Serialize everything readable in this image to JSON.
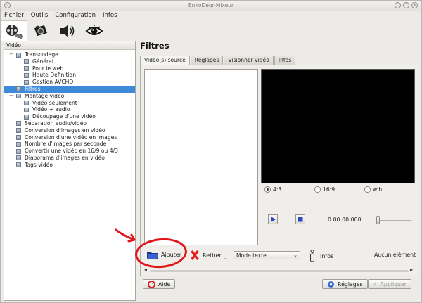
{
  "window": {
    "title": "EnKoDeur-Mixeur"
  },
  "menu": {
    "items": [
      {
        "label": "Fichier"
      },
      {
        "label": "Outils"
      },
      {
        "label": "Configuration"
      },
      {
        "label": "Infos"
      }
    ]
  },
  "toolbar": {
    "icons": [
      "film-reel-icon",
      "camera-icon",
      "speaker-icon",
      "eye-icon"
    ],
    "active_index": 0
  },
  "tree": {
    "header": "Vidéo",
    "items": [
      {
        "label": "Transcodage",
        "level": 0,
        "expanded": true
      },
      {
        "label": "Général",
        "level": 1
      },
      {
        "label": "Pour le web",
        "level": 1
      },
      {
        "label": "Haute Définition",
        "level": 1
      },
      {
        "label": "Gestion AVCHD",
        "level": 1
      },
      {
        "label": "Filtres",
        "level": 0,
        "selected": true
      },
      {
        "label": "Montage vidéo",
        "level": 0,
        "expanded": true
      },
      {
        "label": "Vidéo seulement",
        "level": 1
      },
      {
        "label": "Vidéo + audio",
        "level": 1
      },
      {
        "label": "Découpage d'une vidéo",
        "level": 1
      },
      {
        "label": "Séparation audio/vidéo",
        "level": 0
      },
      {
        "label": "Conversion d'images en vidéo",
        "level": 0
      },
      {
        "label": "Conversion d'une vidéo en images",
        "level": 0
      },
      {
        "label": "Nombre d'images par seconde",
        "level": 0
      },
      {
        "label": "Convertir une vidéo en 16/9 ou 4/3",
        "level": 0
      },
      {
        "label": "Diaporama d'images en vidéo",
        "level": 0
      },
      {
        "label": "Tags vidéo",
        "level": 0
      }
    ]
  },
  "main": {
    "title": "Filtres",
    "tabs": [
      {
        "label": "Vidéo(s) source",
        "active": true
      },
      {
        "label": "Réglages"
      },
      {
        "label": "Visionner vidéo"
      },
      {
        "label": "Infos"
      }
    ],
    "aspect": {
      "options": [
        {
          "label": "4:3",
          "checked": true
        },
        {
          "label": "16:9"
        },
        {
          "label": "w:h"
        }
      ]
    },
    "player": {
      "timecode": "0:00:00:000",
      "position": 0
    },
    "actions": {
      "add_label": "Ajouter",
      "remove_label": "Retirer",
      "mode_selected": "Mode texte",
      "infos_label": "Infos",
      "status": "Aucun élément"
    }
  },
  "footer": {
    "help_label": "Aide",
    "settings_label": "Réglages",
    "apply_label": "Appliquer"
  },
  "colors": {
    "selection": "#3d8ad8",
    "annotation": "#e2151b",
    "video_bg": "#000000"
  }
}
